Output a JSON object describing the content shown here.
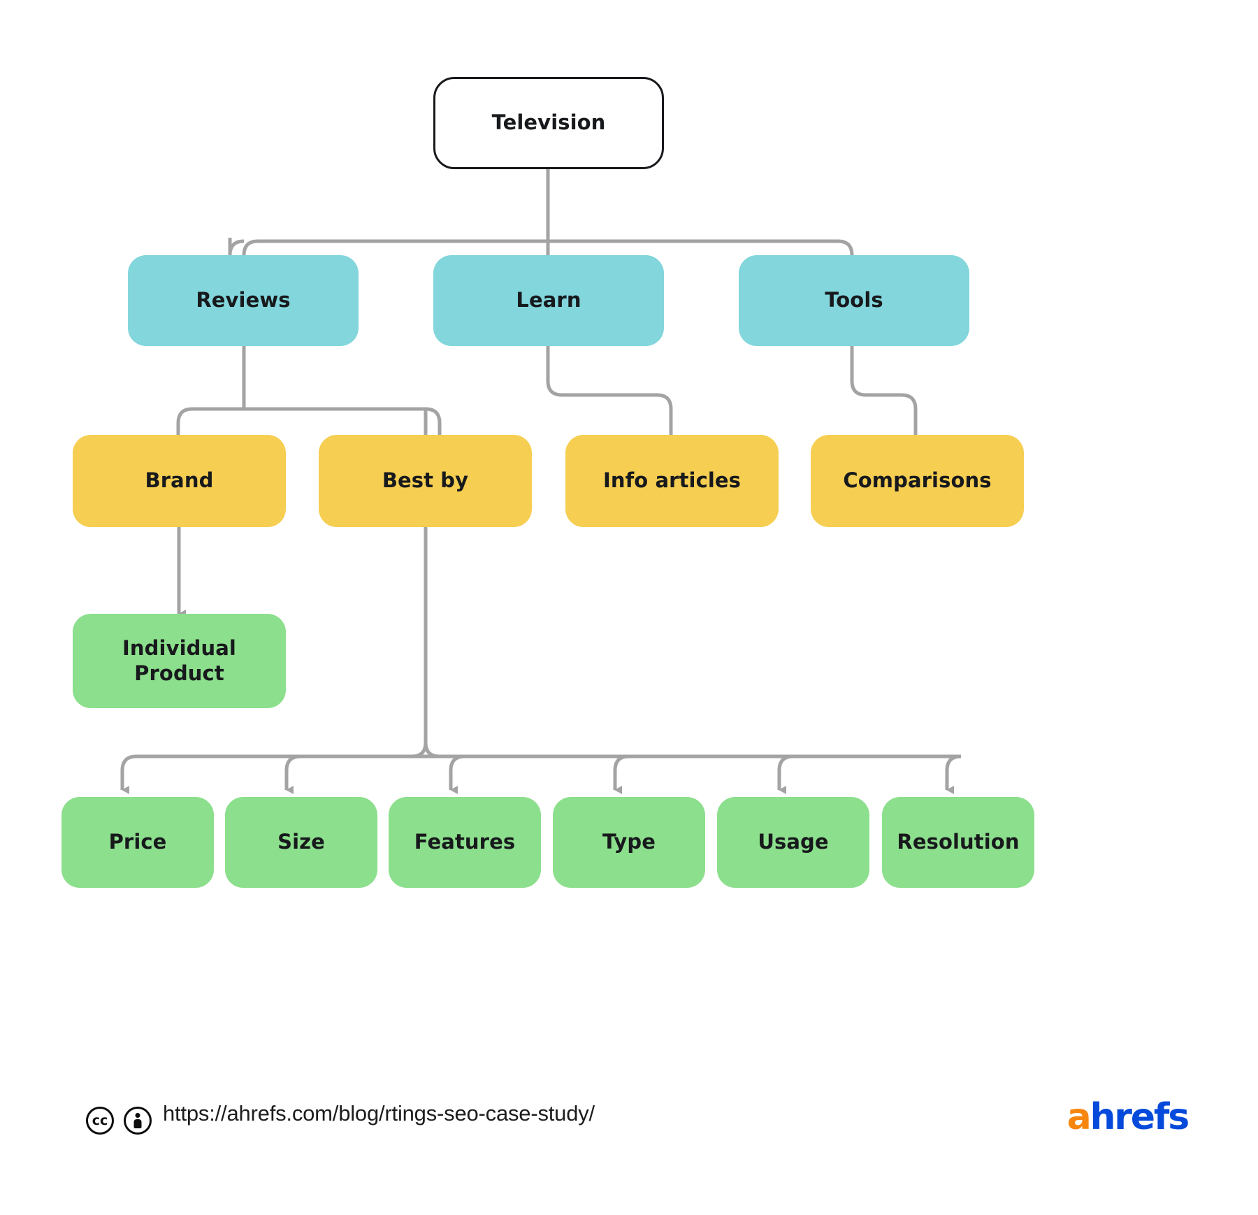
{
  "diagram": {
    "type": "site-structure-tree",
    "title_node": "Television",
    "levels": [
      {
        "name": "root",
        "color": "#ffffff",
        "nodes": [
          "Television"
        ]
      },
      {
        "name": "category",
        "color": "#82d6dc",
        "nodes": [
          "Reviews",
          "Learn",
          "Tools"
        ]
      },
      {
        "name": "subcategory",
        "color": "#f5ce52",
        "nodes": [
          "Brand",
          "Best by",
          "Info articles",
          "Comparisons"
        ]
      },
      {
        "name": "leaf",
        "color": "#8cdf8c",
        "nodes": [
          "Individual Product",
          "Price",
          "Size",
          "Features",
          "Type",
          "Usage",
          "Resolution"
        ]
      }
    ],
    "edges": [
      {
        "from": "Television",
        "to": "Reviews"
      },
      {
        "from": "Television",
        "to": "Learn"
      },
      {
        "from": "Television",
        "to": "Tools"
      },
      {
        "from": "Reviews",
        "to": "Brand"
      },
      {
        "from": "Reviews",
        "to": "Best by"
      },
      {
        "from": "Learn",
        "to": "Info articles"
      },
      {
        "from": "Tools",
        "to": "Comparisons"
      },
      {
        "from": "Brand",
        "to": "Individual Product"
      },
      {
        "from": "Best by",
        "to": "Price"
      },
      {
        "from": "Best by",
        "to": "Size"
      },
      {
        "from": "Best by",
        "to": "Features"
      },
      {
        "from": "Best by",
        "to": "Type"
      },
      {
        "from": "Best by",
        "to": "Usage"
      },
      {
        "from": "Best by",
        "to": "Resolution"
      }
    ]
  },
  "nodes": {
    "root": {
      "label": "Television"
    },
    "reviews": {
      "label": "Reviews"
    },
    "learn": {
      "label": "Learn"
    },
    "tools": {
      "label": "Tools"
    },
    "brand": {
      "label": "Brand"
    },
    "best_by": {
      "label": "Best by"
    },
    "info_articles": {
      "label": "Info articles"
    },
    "comparisons": {
      "label": "Comparisons"
    },
    "individual_product": {
      "label": "Individual\nProduct"
    },
    "individual_product_line1": {
      "label": "Individual"
    },
    "individual_product_line2": {
      "label": "Product"
    },
    "price": {
      "label": "Price"
    },
    "size": {
      "label": "Size"
    },
    "features": {
      "label": "Features"
    },
    "type": {
      "label": "Type"
    },
    "usage": {
      "label": "Usage"
    },
    "resolution": {
      "label": "Resolution"
    }
  },
  "footer": {
    "license_icons": [
      "creative-commons-icon",
      "creative-commons-by-icon"
    ],
    "cc_label": "cc",
    "url": "https://ahrefs.com/blog/rtings-seo-case-study/",
    "logo_a": "a",
    "logo_rest": "hrefs"
  },
  "colors": {
    "background": "#ffffff",
    "root_border": "#17191c",
    "teal": "#82d6dc",
    "yellow": "#f5ce52",
    "green": "#8cdf8c",
    "connector": "#a3a3a3",
    "text": "#17191c",
    "logo_orange": "#f7860f",
    "logo_blue": "#054ada"
  }
}
